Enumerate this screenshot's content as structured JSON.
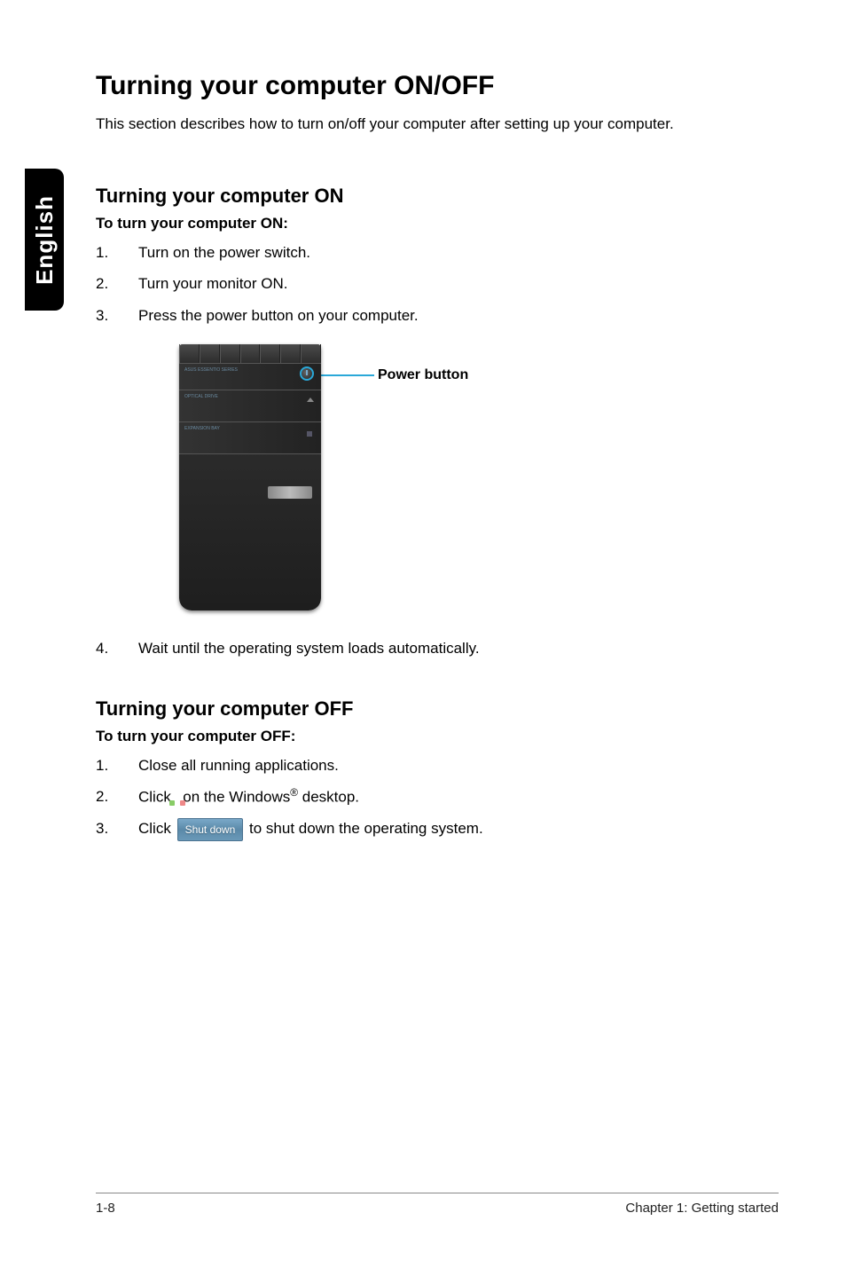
{
  "sideTab": "English",
  "title": "Turning your computer ON/OFF",
  "intro": "This section describes how to turn on/off your computer after setting up your computer.",
  "onSection": {
    "heading": "Turning your computer ON",
    "sub": "To turn your computer ON:",
    "steps": [
      "Turn on the power switch.",
      "Turn your monitor ON.",
      "Press the power button on your computer."
    ],
    "callout": "Power button",
    "step4": "Wait until the operating system loads automatically."
  },
  "tower": {
    "brandLine": "ASUS ESSENTIO SERIES",
    "optical": "OPTICAL DRIVE",
    "expansion": "EXPANSION BAY"
  },
  "offSection": {
    "heading": "Turning your computer OFF",
    "sub": "To turn your computer OFF:",
    "step1": "Close all running applications.",
    "step2_a": "Click ",
    "step2_b": " on the Windows",
    "step2_c": " desktop.",
    "step3_a": "Click ",
    "shutdownLabel": "Shut down",
    "step3_b": " to shut down the operating system."
  },
  "footer": {
    "left": "1-8",
    "right": "Chapter 1: Getting started"
  }
}
